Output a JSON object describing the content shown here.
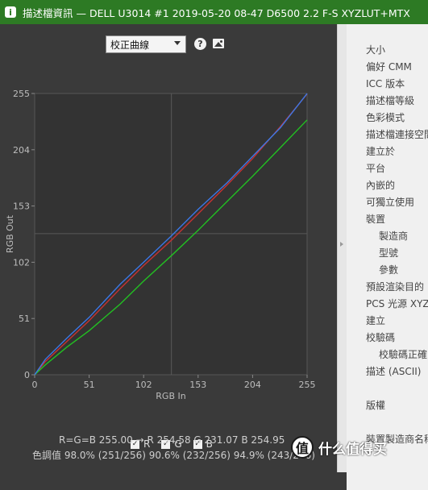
{
  "window": {
    "title": "描述檔資訊 — DELL U3014 #1 2019-05-20 08-47 D6500 2.2 F-S XYZLUT+MTX",
    "app_icon": "i"
  },
  "toolbar": {
    "curve_select": "校正曲線",
    "help_icon": "?"
  },
  "chart_data": {
    "type": "line",
    "xlabel": "RGB In",
    "ylabel": "RGB Out",
    "xlim": [
      0,
      255
    ],
    "ylim": [
      0,
      255
    ],
    "x_ticks": [
      "0",
      "51",
      "102",
      "153",
      "204",
      "255"
    ],
    "y_ticks": [
      "0",
      "51",
      "102",
      "153",
      "204",
      "255"
    ],
    "crosshair": {
      "x": 128,
      "y": 128
    },
    "series": [
      {
        "name": "R",
        "color": "#c83232",
        "x": [
          0,
          10,
          30,
          51,
          80,
          102,
          128,
          153,
          180,
          204,
          230,
          255
        ],
        "y": [
          0,
          12,
          30,
          49,
          78,
          99,
          122,
          146,
          172,
          196,
          225,
          254.58
        ]
      },
      {
        "name": "G",
        "color": "#22c022",
        "x": [
          0,
          10,
          30,
          51,
          80,
          102,
          128,
          153,
          180,
          204,
          230,
          255
        ],
        "y": [
          0,
          9,
          25,
          40,
          64,
          85,
          108,
          131,
          157,
          180,
          206,
          231.07
        ]
      },
      {
        "name": "B",
        "color": "#3b78e7",
        "x": [
          0,
          10,
          30,
          51,
          80,
          102,
          128,
          153,
          180,
          204,
          230,
          255
        ],
        "y": [
          0,
          14,
          33,
          52,
          82,
          102,
          126,
          150,
          174,
          198,
          224,
          254.95
        ]
      }
    ]
  },
  "channels": [
    {
      "label": "R",
      "checked": true
    },
    {
      "label": "G",
      "checked": true
    },
    {
      "label": "B",
      "checked": true
    }
  ],
  "summary": {
    "line1": "R=G=B 255.00 → R 254.58 G 231.07 B 254.95",
    "line2": "色調值 98.0% (251/256) 90.6% (232/256) 94.9% (243/256)"
  },
  "info_panel": {
    "items": [
      {
        "label": "大小",
        "indent": 0
      },
      {
        "label": "偏好 CMM",
        "indent": 0
      },
      {
        "label": "ICC 版本",
        "indent": 0
      },
      {
        "label": "描述檔等級",
        "indent": 0
      },
      {
        "label": "色彩模式",
        "indent": 0
      },
      {
        "label": "描述檔連接空間",
        "indent": 0
      },
      {
        "label": "建立於",
        "indent": 0
      },
      {
        "label": "平台",
        "indent": 0
      },
      {
        "label": "內嵌的",
        "indent": 0
      },
      {
        "label": "可獨立使用",
        "indent": 0
      },
      {
        "label": "裝置",
        "indent": 0
      },
      {
        "label": "製造商",
        "indent": 1
      },
      {
        "label": "型號",
        "indent": 1
      },
      {
        "label": "參數",
        "indent": 1
      },
      {
        "label": "預設渲染目的",
        "indent": 0
      },
      {
        "label": "PCS 光源 XYZ",
        "indent": 0
      },
      {
        "label": "建立",
        "indent": 0
      },
      {
        "label": "校驗碼",
        "indent": 0
      },
      {
        "label": "校驗碼正確",
        "indent": 1
      },
      {
        "label": "描述 (ASCII)",
        "indent": 0
      },
      {
        "label": "",
        "indent": 0
      },
      {
        "label": "版權",
        "indent": 0
      },
      {
        "label": "",
        "indent": 0
      },
      {
        "label": "裝置製造商名稱",
        "indent": 0
      }
    ]
  },
  "watermark": {
    "icon_text": "值",
    "text": "什么值得买"
  }
}
